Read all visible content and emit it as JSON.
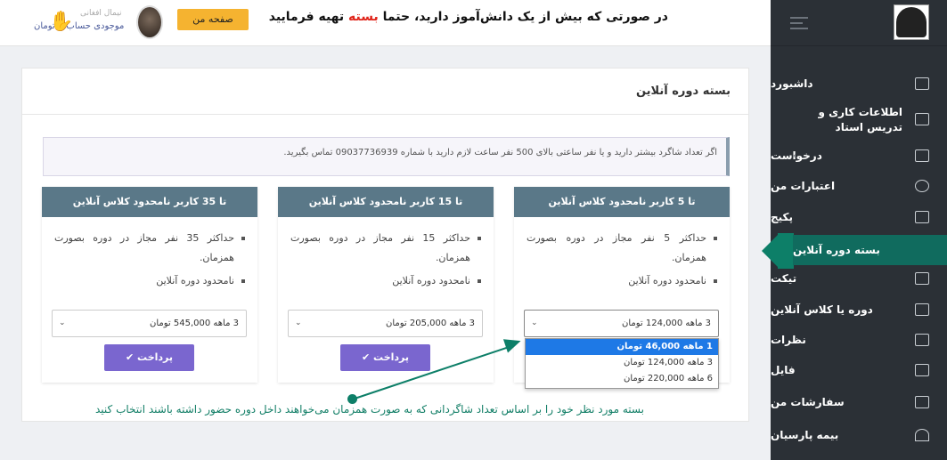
{
  "topbar": {
    "notice_pre": "در صورتی که بیش از یک دانش‌آموز دارید، حتما ",
    "notice_red": "بسته",
    "notice_post": " تهیه فرمایید",
    "page_button": "صفحه من",
    "user_name": "نیمال افغانی",
    "balance": "موجودی حساب 0 تومان"
  },
  "sidebar": {
    "items": [
      {
        "label": "داشبورد",
        "icon": "dashboard-icon"
      },
      {
        "label": "اطلاعات کاری و تدریس استاد",
        "icon": "id-card-icon"
      },
      {
        "label": "درخواست",
        "icon": "request-icon"
      },
      {
        "label": "اعتبارات من",
        "icon": "credit-icon"
      },
      {
        "label": "پکیج",
        "icon": "package-icon"
      },
      {
        "label": "بسته دوره آنلاین",
        "icon": ""
      },
      {
        "label": "تیکت",
        "icon": "ticket-icon"
      },
      {
        "label": "دوره یا کلاس آنلاین",
        "icon": "online-class-icon"
      },
      {
        "label": "نظرات",
        "icon": "comment-icon"
      },
      {
        "label": "فایل",
        "icon": "file-icon"
      },
      {
        "label": "سفارشات من",
        "icon": "cart-icon"
      },
      {
        "label": "بیمه پارسیان",
        "icon": "umbrella-icon"
      }
    ]
  },
  "card": {
    "title": "بسته دوره آنلاین",
    "info": "اگر تعداد شاگرد بیشتر دارید و یا نفر ساعتی بالای 500 نفر ساعت لازم دارید با شماره 09037736939 تماس بگیرید."
  },
  "packages": [
    {
      "title": "تا 5 کاربر نامحدود کلاس آنلاین",
      "line1": "حداکثر 5 نفر مجاز در دوره بصورت همزمان.",
      "line2": "نامحدود دوره آنلاین",
      "selected": "3 ماهه 124,000 تومان",
      "pay": "پرداخت"
    },
    {
      "title": "تا 15 کاربر نامحدود کلاس آنلاین",
      "line1": "حداکثر 15 نفر مجاز در دوره بصورت همزمان.",
      "line2": "نامحدود دوره آنلاین",
      "selected": "3 ماهه 205,000 تومان",
      "pay": "پرداخت"
    },
    {
      "title": "تا 35 کاربر نامحدود کلاس آنلاین",
      "line1": "حداکثر 35 نفر مجاز در دوره بصورت همزمان.",
      "line2": "نامحدود دوره آنلاین",
      "selected": "3 ماهه 545,000 تومان",
      "pay": "پرداخت"
    }
  ],
  "dropdown": {
    "options": [
      "1 ماهه 46,000 تومان",
      "3 ماهه 124,000 تومان",
      "6 ماهه 220,000 تومان"
    ]
  },
  "hint": "بسته مورد نظر خود را بر اساس تعداد شاگردانی که به صورت همزمان می‌خواهند داخل دوره حضور داشته باشند انتخاب کنید",
  "colors": {
    "accent": "#0d7f68",
    "pay": "#7a66cf",
    "pkg_header": "#5a7888",
    "highlight": "#e0261b"
  }
}
